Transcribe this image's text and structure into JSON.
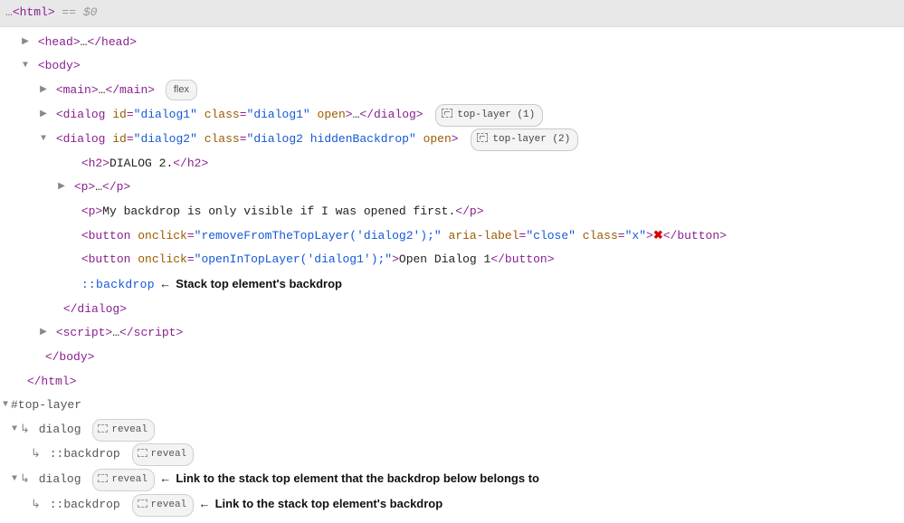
{
  "topbar": {
    "ellipsis": "…",
    "root_open": "<html>",
    "eq": " == ",
    "sel": "$0"
  },
  "tree": {
    "html_close": "</html>",
    "head": {
      "open": "<head>",
      "dots": "…",
      "close": "</head>"
    },
    "body": {
      "open": "<body>",
      "close": "</body>"
    },
    "main": {
      "open": "<main>",
      "dots": "…",
      "close": "</main>",
      "badge": "flex"
    },
    "dialog1": {
      "prefix": "<dialog ",
      "id_attr": "id",
      "id_val": "\"dialog1\"",
      "class_attr": "class",
      "class_val": "\"dialog1\"",
      "open_attr": "open",
      "suffix": ">",
      "dots": "…",
      "close": "</dialog>",
      "badge": "top-layer (1)"
    },
    "dialog2": {
      "prefix": "<dialog ",
      "id_attr": "id",
      "id_val": "\"dialog2\"",
      "class_attr": "class",
      "class_val": "\"dialog2 hiddenBackdrop\"",
      "open_attr": "open",
      "suffix": ">",
      "close": "</dialog>",
      "badge": "top-layer (2)",
      "h2": {
        "open": "<h2>",
        "text": "DIALOG 2.",
        "close": "</h2>"
      },
      "p1": {
        "open": "<p>",
        "dots": "…",
        "close": "</p>"
      },
      "p2": {
        "open": "<p>",
        "text": "My backdrop is only visible if I was opened first.",
        "close": "</p>"
      },
      "btn_close": {
        "prefix": "<button ",
        "onclick_attr": "onclick",
        "onclick_val": "\"removeFromTheTopLayer('dialog2');\"",
        "aria_attr": "aria-label",
        "aria_val": "\"close\"",
        "class_attr": "class",
        "class_val": "\"x\"",
        "suffix": ">",
        "icon": "✖",
        "close": "</button>"
      },
      "btn_open": {
        "prefix": "<button ",
        "onclick_attr": "onclick",
        "onclick_val": "\"openInTopLayer('dialog1');\"",
        "suffix": ">",
        "text": "Open Dialog 1",
        "close": "</button>"
      },
      "backdrop": {
        "pseudo": "::backdrop",
        "note": "Stack top element's backdrop"
      }
    },
    "script": {
      "open": "<script>",
      "dots": "…",
      "close": "</sc"
    }
  },
  "toplayer": {
    "header": "#top-layer",
    "items": [
      {
        "label": "dialog",
        "reveal": "reveal",
        "note": ""
      },
      {
        "label": "::backdrop",
        "reveal": "reveal",
        "note": ""
      },
      {
        "label": "dialog",
        "reveal": "reveal",
        "note": "Link to the stack top element that the backdrop below belongs to"
      },
      {
        "label": "::backdrop",
        "reveal": "reveal",
        "note": "Link to the stack top element's backdrop"
      }
    ]
  },
  "arrow": "←"
}
